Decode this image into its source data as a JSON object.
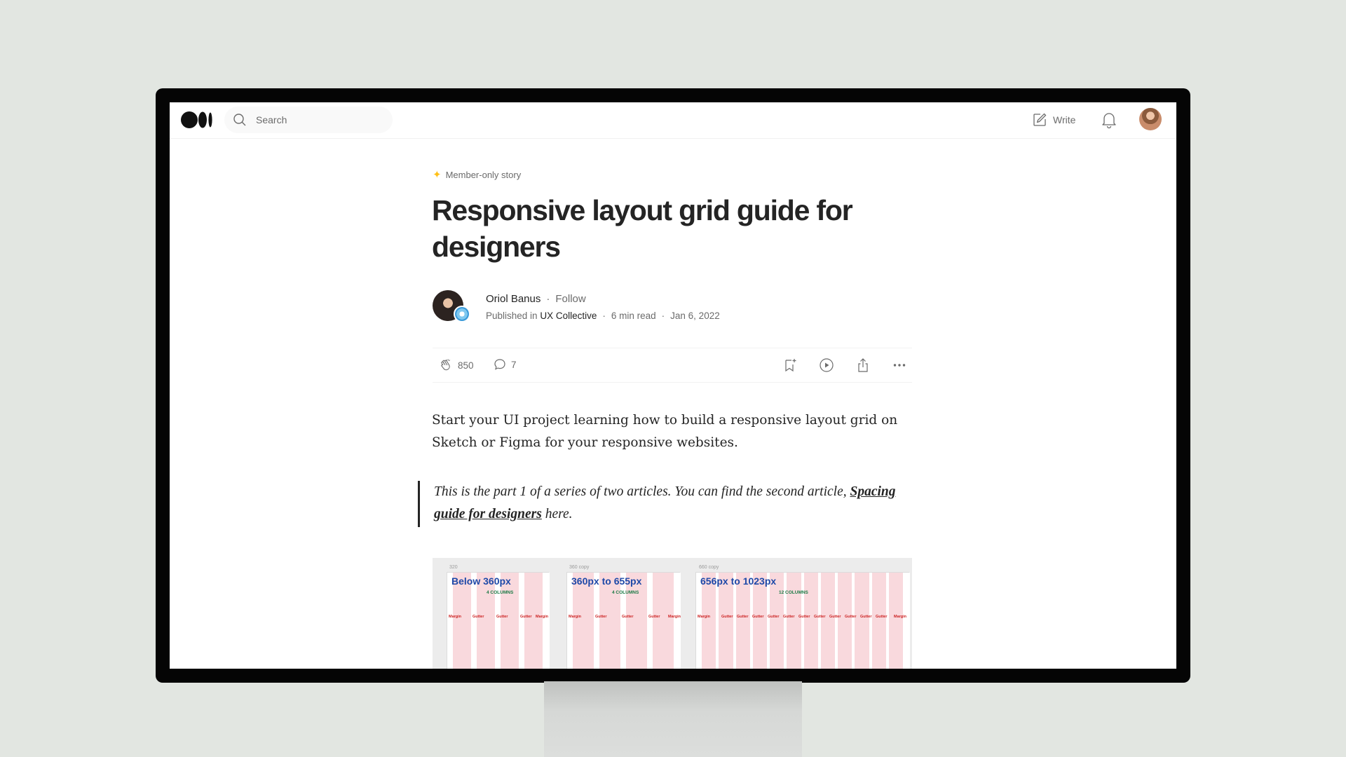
{
  "topbar": {
    "logo_icon": "medium-logo-icon",
    "search_placeholder": "Search",
    "write_label": "Write"
  },
  "article": {
    "member_label": "Member-only story",
    "title": "Responsive layout grid guide for designers",
    "author": "Oriol Banus",
    "follow_label": "Follow",
    "published_prefix": "Published in",
    "publication": "UX Collective",
    "read_time": "6 min read",
    "date": "Jan 6, 2022",
    "claps": "850",
    "comments": "7",
    "intro": "Start your UI project learning how to build a responsive layout grid on Sketch or Figma for your responsive websites.",
    "quote_before": "This is the part 1 of a series of two articles. You can find the second article, ",
    "quote_link": "Spacing guide for designers",
    "quote_after": " here."
  },
  "figure": {
    "panels": [
      {
        "tag": "320",
        "title": "Below 360px",
        "columns": "4 COLUMNS"
      },
      {
        "tag": "360 copy",
        "title": "360px to 655px",
        "columns": "4 COLUMNS"
      },
      {
        "tag": "660 copy",
        "title": "656px to 1023px",
        "columns": "12 COLUMNS"
      }
    ]
  },
  "colors": {
    "accent_star": "#ffc017",
    "text_primary": "#242424",
    "text_secondary": "#6b6b6b",
    "grid_title_blue": "#1e49a8",
    "grid_column_pink": "#f9d9dd"
  }
}
